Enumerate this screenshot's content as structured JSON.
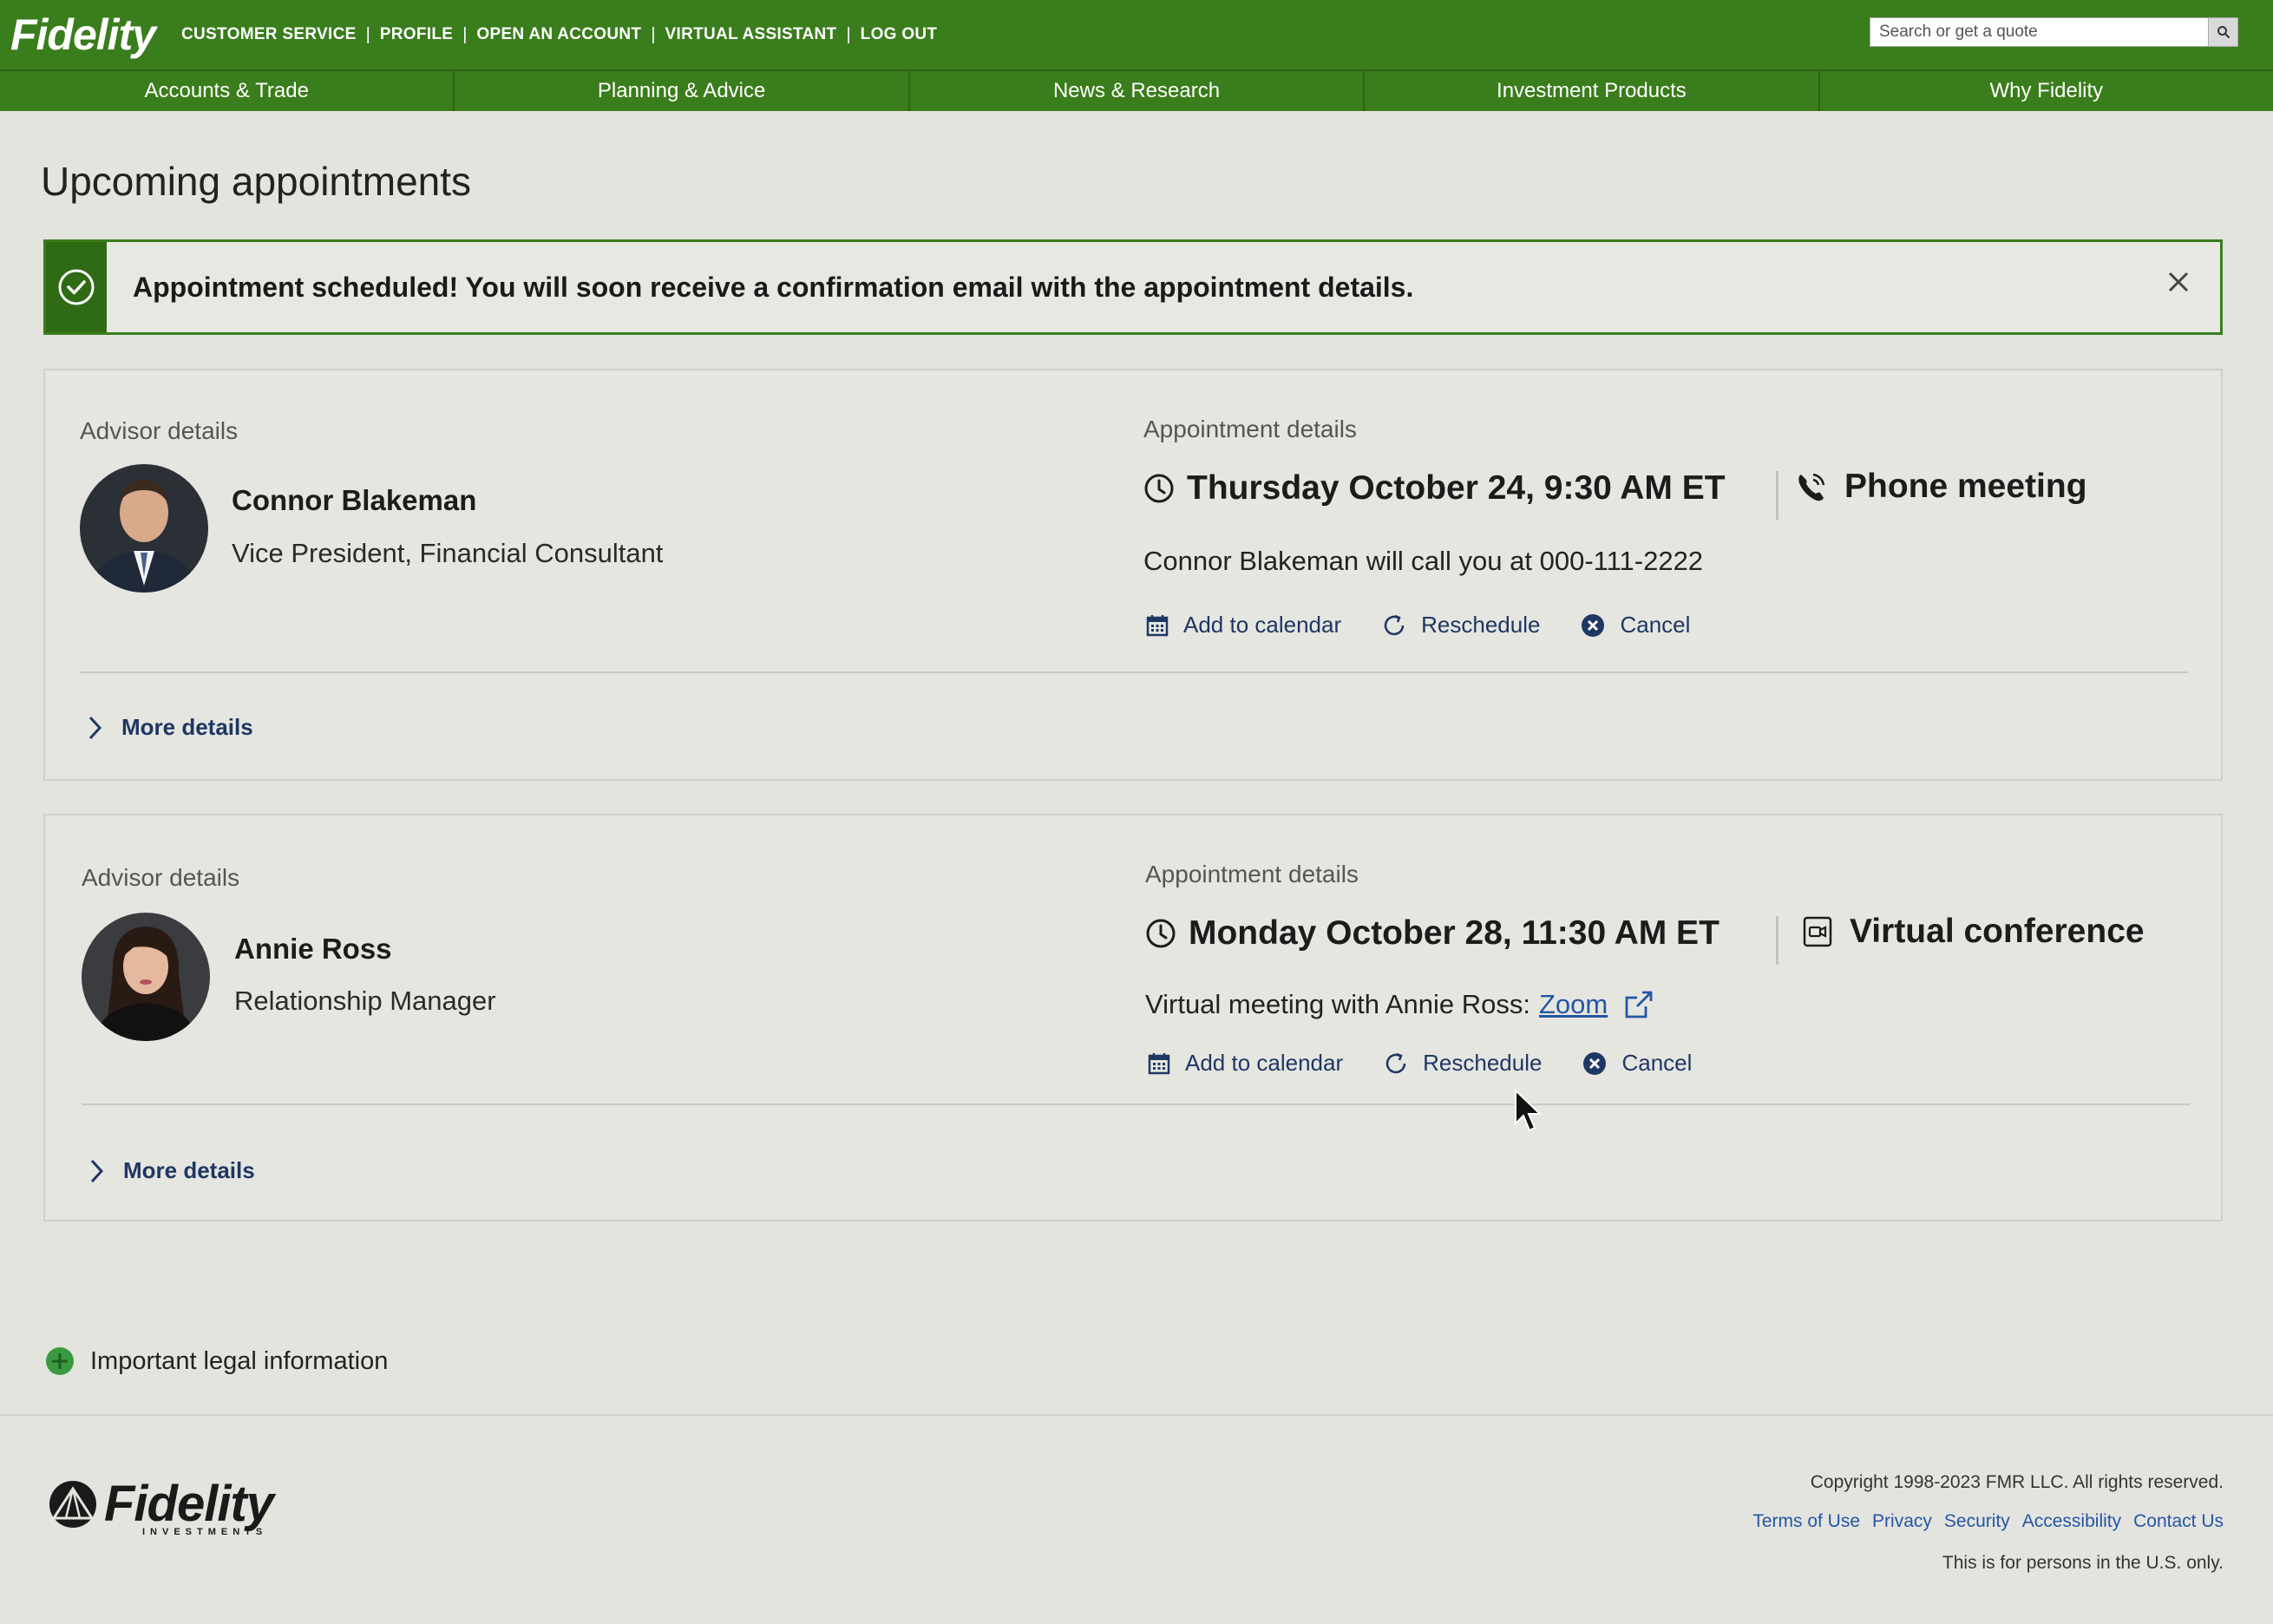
{
  "header": {
    "logo": "Fidelity",
    "utility_links": [
      "CUSTOMER SERVICE",
      "PROFILE",
      "OPEN AN ACCOUNT",
      "VIRTUAL ASSISTANT",
      "LOG OUT"
    ],
    "search_placeholder": "Search or get a quote"
  },
  "nav": [
    "Accounts & Trade",
    "Planning & Advice",
    "News & Research",
    "Investment Products",
    "Why Fidelity"
  ],
  "page": {
    "title": "Upcoming appointments",
    "alert": "Appointment scheduled! You will soon receive a confirmation email with the appointment details."
  },
  "appointments": [
    {
      "advisor_label": "Advisor details",
      "advisor_name": "Connor Blakeman",
      "advisor_role": "Vice President, Financial Consultant",
      "details_label": "Appointment details",
      "when": "Thursday October 24, 9:30 AM ET",
      "type": "Phone meeting",
      "type_icon": "phone-icon",
      "description": "Connor Blakeman will call you at 000-111-2222",
      "link_text": "",
      "actions": [
        "Add to calendar",
        "Reschedule",
        "Cancel"
      ],
      "more": "More details"
    },
    {
      "advisor_label": "Advisor details",
      "advisor_name": "Annie Ross",
      "advisor_role": "Relationship Manager",
      "details_label": "Appointment details",
      "when": "Monday October 28, 11:30 AM ET",
      "type": "Virtual conference",
      "type_icon": "video-icon",
      "description": "Virtual meeting with Annie Ross:",
      "link_text": "Zoom",
      "actions": [
        "Add to calendar",
        "Reschedule",
        "Cancel"
      ],
      "more": "More details"
    }
  ],
  "legal": "Important legal information",
  "footer": {
    "logo": "Fidelity",
    "logo_sub": "INVESTMENTS",
    "copyright": "Copyright 1998-2023 FMR LLC. All rights reserved.",
    "links": [
      "Terms of Use",
      "Privacy",
      "Security",
      "Accessibility",
      "Contact Us"
    ],
    "us_only": "This is for persons in the U.S. only."
  },
  "colors": {
    "brand_green": "#3a7d1c",
    "link_blue": "#2456a5",
    "action_navy": "#1e3763"
  }
}
